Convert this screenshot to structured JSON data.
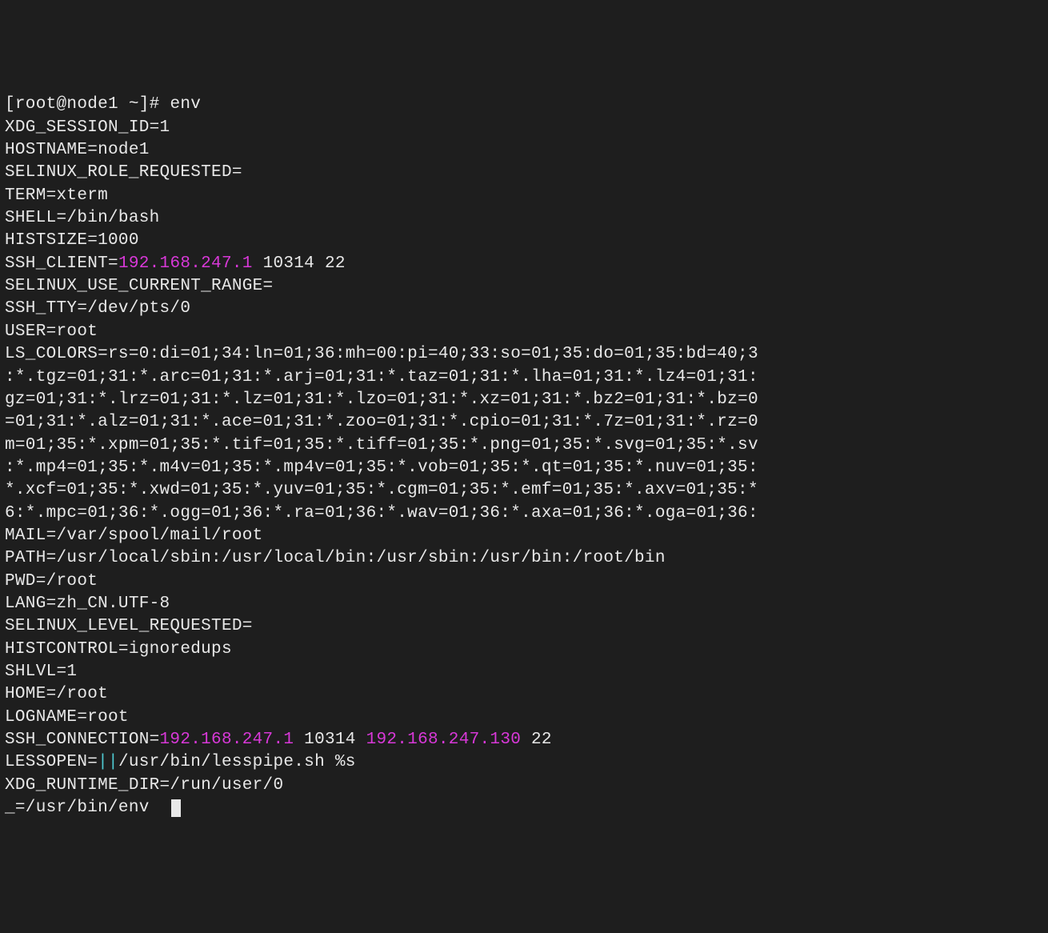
{
  "terminal": {
    "prompt": "[root@node1 ~]# ",
    "command": "env",
    "lines": [
      {
        "text": "XDG_SESSION_ID=1"
      },
      {
        "text": "HOSTNAME=node1"
      },
      {
        "text": "SELINUX_ROLE_REQUESTED="
      },
      {
        "text": "TERM=xterm"
      },
      {
        "text": "SHELL=/bin/bash"
      },
      {
        "text": "HISTSIZE=1000"
      },
      {
        "prefix": "SSH_CLIENT=",
        "ip1": "192.168.247.1",
        "suffix": " 10314 22"
      },
      {
        "text": "SELINUX_USE_CURRENT_RANGE="
      },
      {
        "text": "SSH_TTY=/dev/pts/0"
      },
      {
        "text": "USER=root"
      },
      {
        "text": "LS_COLORS=rs=0:di=01;34:ln=01;36:mh=00:pi=40;33:so=01;35:do=01;35:bd=40;3"
      },
      {
        "text": ":*.tgz=01;31:*.arc=01;31:*.arj=01;31:*.taz=01;31:*.lha=01;31:*.lz4=01;31:"
      },
      {
        "text": "gz=01;31:*.lrz=01;31:*.lz=01;31:*.lzo=01;31:*.xz=01;31:*.bz2=01;31:*.bz=0"
      },
      {
        "text": "=01;31:*.alz=01;31:*.ace=01;31:*.zoo=01;31:*.cpio=01;31:*.7z=01;31:*.rz=0"
      },
      {
        "text": "m=01;35:*.xpm=01;35:*.tif=01;35:*.tiff=01;35:*.png=01;35:*.svg=01;35:*.sv"
      },
      {
        "text": ":*.mp4=01;35:*.m4v=01;35:*.mp4v=01;35:*.vob=01;35:*.qt=01;35:*.nuv=01;35:"
      },
      {
        "text": "*.xcf=01;35:*.xwd=01;35:*.yuv=01;35:*.cgm=01;35:*.emf=01;35:*.axv=01;35:*"
      },
      {
        "text": "6:*.mpc=01;36:*.ogg=01;36:*.ra=01;36:*.wav=01;36:*.axa=01;36:*.oga=01;36:"
      },
      {
        "text": "MAIL=/var/spool/mail/root"
      },
      {
        "text": "PATH=/usr/local/sbin:/usr/local/bin:/usr/sbin:/usr/bin:/root/bin"
      },
      {
        "text": "PWD=/root"
      },
      {
        "text": "LANG=zh_CN.UTF-8"
      },
      {
        "text": "SELINUX_LEVEL_REQUESTED="
      },
      {
        "text": "HISTCONTROL=ignoredups"
      },
      {
        "text": "SHLVL=1"
      },
      {
        "text": "HOME=/root"
      },
      {
        "text": "LOGNAME=root"
      },
      {
        "prefix": "SSH_CONNECTION=",
        "ip1": "192.168.247.1",
        "mid": " 10314 ",
        "ip2": "192.168.247.130",
        "suffix": " 22"
      },
      {
        "prefix": "LESSOPEN=",
        "pipe": "||",
        "suffix": "/usr/bin/lesspipe.sh %s"
      },
      {
        "text": "XDG_RUNTIME_DIR=/run/user/0"
      },
      {
        "text": "_=/usr/bin/env"
      }
    ]
  }
}
